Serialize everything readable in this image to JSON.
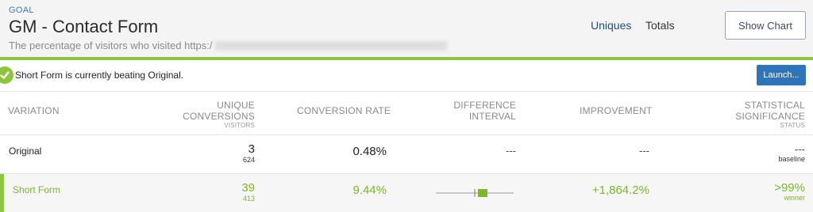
{
  "header": {
    "eyebrow": "GOAL",
    "title": "GM - Contact Form",
    "subtitle": "The percentage of visitors who visited https:/",
    "views": {
      "uniques": "Uniques",
      "totals": "Totals"
    },
    "show_chart_label": "Show Chart"
  },
  "banner": {
    "message": "Short Form is currently beating Original.",
    "launch_label": "Launch..."
  },
  "table": {
    "columns": {
      "variation": "VARIATION",
      "unique_conversions": "UNIQUE\nCONVERSIONS",
      "unique_conversions_sub": "VISITORS",
      "conversion_rate": "CONVERSION RATE",
      "difference_interval": "DIFFERENCE\nINTERVAL",
      "improvement": "IMPROVEMENT",
      "statistical_significance": "STATISTICAL\nSIGNIFICANCE",
      "statistical_significance_sub": "STATUS"
    },
    "rows": [
      {
        "variation": "Original",
        "conversions": "3",
        "visitors": "624",
        "conversion_rate": "0.48%",
        "difference_interval": "---",
        "improvement": "---",
        "significance": "---",
        "status": "baseline"
      },
      {
        "variation": "Short Form",
        "conversions": "39",
        "visitors": "413",
        "conversion_rate": "9.44%",
        "interval": {
          "low": 3.6,
          "high": 14.6,
          "zero": 0,
          "scale_min": -45,
          "scale_max": 45
        },
        "improvement": "+1,864.2%",
        "significance": ">99%",
        "status": "winner"
      }
    ]
  },
  "colors": {
    "accent_green": "#8cc63f",
    "winner_text": "#7ab828",
    "brand_blue": "#2f73b8",
    "link_blue": "#1e4f86"
  }
}
